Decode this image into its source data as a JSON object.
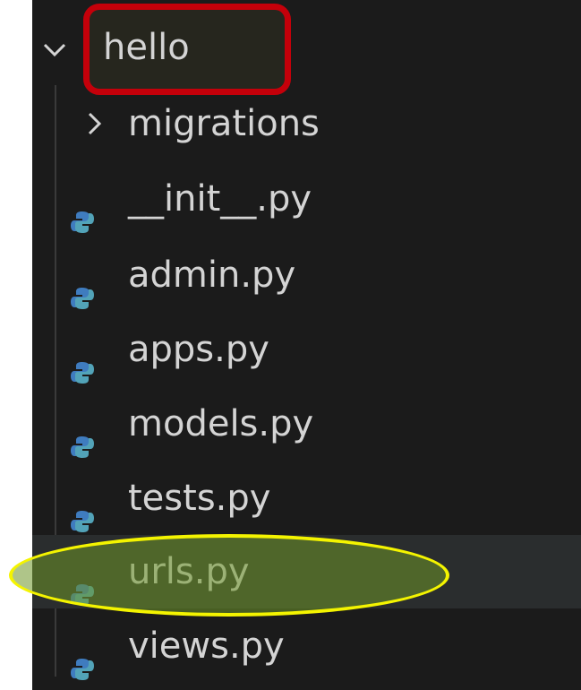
{
  "explorer": {
    "folder": {
      "name": "hello",
      "expanded": true
    },
    "subfolder": {
      "name": "migrations",
      "expanded": false
    },
    "files": [
      {
        "name": "__init__.py",
        "icon": "python-icon"
      },
      {
        "name": "admin.py",
        "icon": "python-icon"
      },
      {
        "name": "apps.py",
        "icon": "python-icon"
      },
      {
        "name": "models.py",
        "icon": "python-icon"
      },
      {
        "name": "tests.py",
        "icon": "python-icon"
      },
      {
        "name": "urls.py",
        "icon": "python-icon",
        "selected": true
      },
      {
        "name": "views.py",
        "icon": "python-icon"
      }
    ]
  },
  "colors": {
    "background": "#1b1b1b",
    "text": "#d4d4d4",
    "highlight_box": "#c4000a",
    "highlight_ellipse": "#f4f400",
    "python_blue": "#3f7cbf",
    "python_teal": "#52a3b8"
  }
}
